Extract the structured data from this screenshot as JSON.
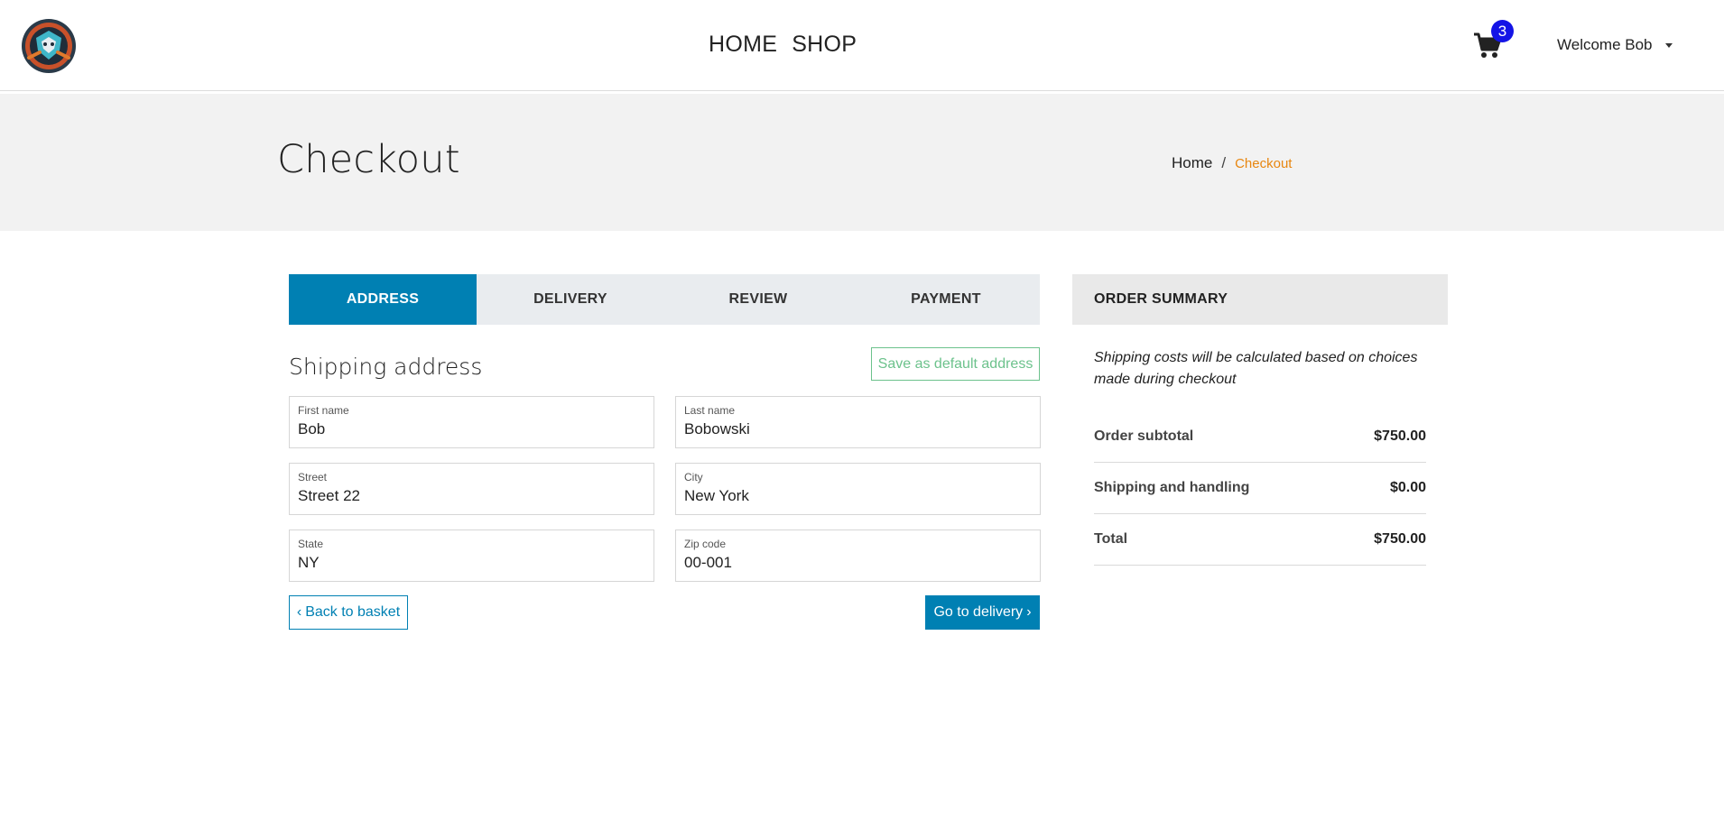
{
  "header": {
    "logo_icon": "shop-mascot-logo",
    "nav": [
      {
        "label": "HOME"
      },
      {
        "label": "SHOP"
      }
    ],
    "cart_icon": "shopping-cart-icon",
    "cart_count": "3",
    "user_menu_label": "Welcome Bob"
  },
  "hero": {
    "title": "Checkout",
    "breadcrumb": {
      "home": "Home",
      "separator": "/",
      "current": "Checkout"
    }
  },
  "steps": [
    {
      "label": "ADDRESS",
      "active": true
    },
    {
      "label": "DELIVERY",
      "active": false
    },
    {
      "label": "REVIEW",
      "active": false
    },
    {
      "label": "PAYMENT",
      "active": false
    }
  ],
  "address_form": {
    "title": "Shipping address",
    "save_default_label": "Save as default address",
    "fields": {
      "first_name": {
        "label": "First name",
        "value": "Bob"
      },
      "last_name": {
        "label": "Last name",
        "value": "Bobowski"
      },
      "street": {
        "label": "Street",
        "value": "Street 22"
      },
      "city": {
        "label": "City",
        "value": "New York"
      },
      "state": {
        "label": "State",
        "value": "NY"
      },
      "zip": {
        "label": "Zip code",
        "value": "00-001"
      }
    },
    "back_label": "Back to basket",
    "next_label": "Go to delivery"
  },
  "order_summary": {
    "title": "ORDER SUMMARY",
    "note": "Shipping costs will be calculated based on choices made during checkout",
    "rows": [
      {
        "label": "Order subtotal",
        "value": "$750.00"
      },
      {
        "label": "Shipping and handling",
        "value": "$0.00"
      },
      {
        "label": "Total",
        "value": "$750.00"
      }
    ]
  },
  "colors": {
    "primary": "#0080b3",
    "accent_orange": "#e8860f",
    "success_outline": "#6cc28c",
    "badge": "#1414e6"
  }
}
